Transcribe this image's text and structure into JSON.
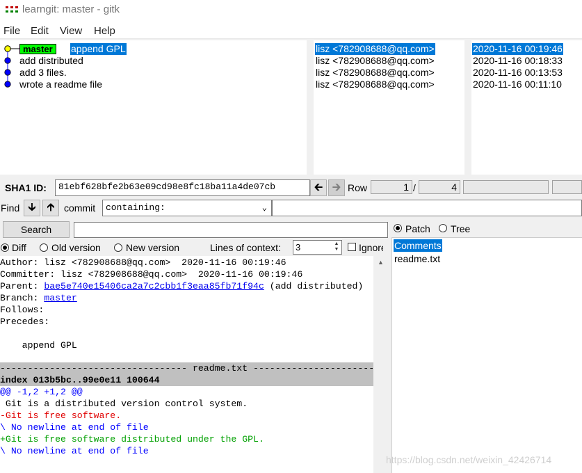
{
  "window": {
    "title": "learngit: master - gitk"
  },
  "menu": [
    "File",
    "Edit",
    "View",
    "Help"
  ],
  "commits": [
    {
      "message": "append GPL",
      "author": "lisz <782908688@qq.com>",
      "date": "2020-11-16 00:19:46",
      "branch": "master"
    },
    {
      "message": "add distributed",
      "author": "lisz <782908688@qq.com>",
      "date": "2020-11-16 00:18:33"
    },
    {
      "message": "add 3 files.",
      "author": "lisz <782908688@qq.com>",
      "date": "2020-11-16 00:13:53"
    },
    {
      "message": "wrote a readme file",
      "author": "lisz <782908688@qq.com>",
      "date": "2020-11-16 00:11:10"
    }
  ],
  "sha": {
    "label": "SHA1 ID:",
    "value": "81ebf628bfe2b63e09cd98e8fc18ba11a4de07cb"
  },
  "row": {
    "label": "Row",
    "current": "1",
    "separator": "/",
    "total": "4"
  },
  "find": {
    "label": "Find",
    "commit_label": "commit",
    "mode": "containing:",
    "search_button": "Search"
  },
  "options": {
    "diff": "Diff",
    "old_version": "Old version",
    "new_version": "New version",
    "context_label": "Lines of context:",
    "context_value": "3",
    "ignore_label": "Ignore space change"
  },
  "diff": {
    "author": "Author: lisz <782908688@qq.com>  2020-11-16 00:19:46",
    "committer": "Committer: lisz <782908688@qq.com>  2020-11-16 00:19:46",
    "parent_label": "Parent: ",
    "parent_hash": "bae5e740e15406ca2a7c2cbb1f3eaa85fb71f94c",
    "parent_suffix": " (add distributed)",
    "branch_label": "Branch: ",
    "branch_name": "master",
    "follows": "Follows:",
    "precedes": "Precedes:",
    "message": "    append GPL",
    "file_header": "---------------------------------- readme.txt ----------------------------------",
    "index_line": "index 013b5bc..99e0e11 100644",
    "hunk": "@@ -1,2 +1,2 @@",
    "context1": " Git is a distributed version control system.",
    "removed": "-Git is free software.",
    "no_newline1": "\\ No newline at end of file",
    "added": "+Git is free software distributed under the GPL.",
    "no_newline2": "\\ No newline at end of file"
  },
  "file_panel": {
    "patch": "Patch",
    "tree": "Tree",
    "items": [
      "Comments",
      "readme.txt"
    ]
  },
  "watermark": "https://blog.csdn.net/weixin_42426714",
  "colors": {
    "selection": "#0078d7",
    "branch_tag": "#00ff00",
    "removed": "#e00000",
    "added": "#00a000",
    "hunk": "#0000ff"
  }
}
